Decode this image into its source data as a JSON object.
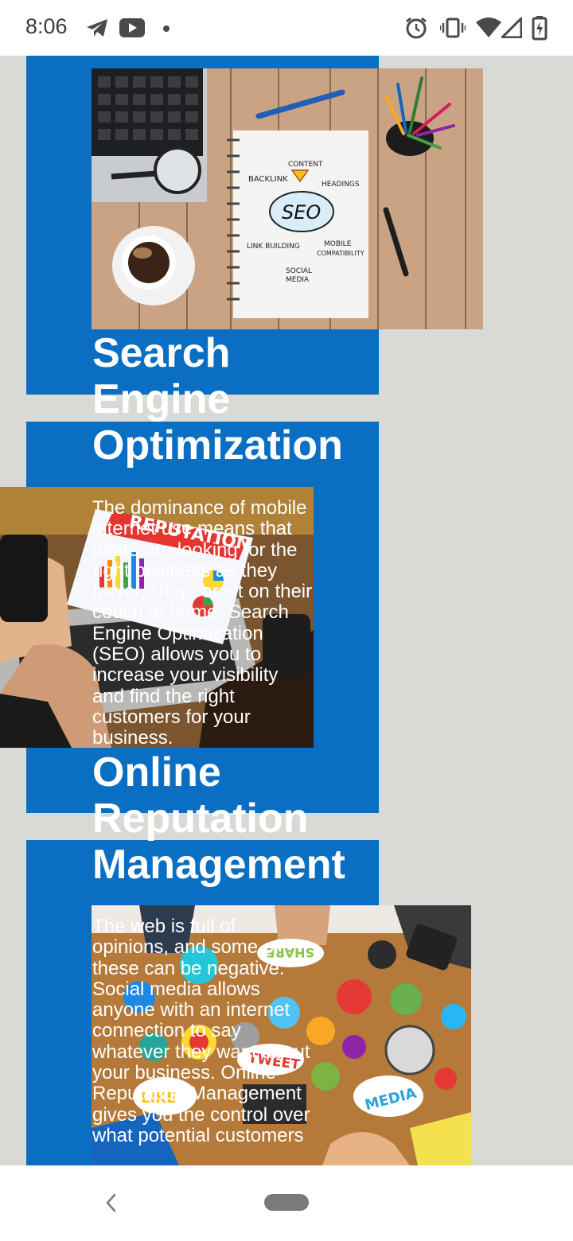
{
  "status_bar": {
    "time": "8:06",
    "icons": [
      "telegram-icon",
      "youtube-icon",
      "dot-icon",
      "alarm-icon",
      "vibrate-icon",
      "wifi-icon",
      "signal-icon",
      "battery-icon"
    ]
  },
  "sections": [
    {
      "image": "seo-notebook-photo",
      "image_text": {
        "content": "CONTENT",
        "backlink": "BACKLINK",
        "headings": "HEADINGS",
        "seo": "SEO",
        "link_building": "LINK BUILDING",
        "mobile": "MOBILE",
        "compatibility": "COMPATIBILITY",
        "social": "SOCIAL",
        "media": "MEDIA"
      },
      "title": "Search Engine Optimization",
      "body": "The dominance of mobile internet use means that users are looking for the right business as they travel, shop, or sit on their couch at home. Search Engine Optimization (SEO) allows you to increase your visibility and find the right customers for your business."
    },
    {
      "image": "reputation-laptop-photo",
      "image_text": {
        "reputation": "REPUTATION"
      },
      "title": "Online Reputation Management",
      "body": "The web is full of opinions, and some of these can be negative. Social media allows anyone with an internet connection to say whatever they want about your business. Online Reputation Management gives you the control over what potential customers"
    },
    {
      "image": "social-media-table-photo",
      "image_text": {
        "share": "SHARE",
        "tweet": "TWEET",
        "media": "MEDIA",
        "like": "LIKE"
      }
    }
  ],
  "colors": {
    "accent_blue": "#0a6fc2",
    "background": "#d9dad6",
    "text": "#ffffff"
  }
}
